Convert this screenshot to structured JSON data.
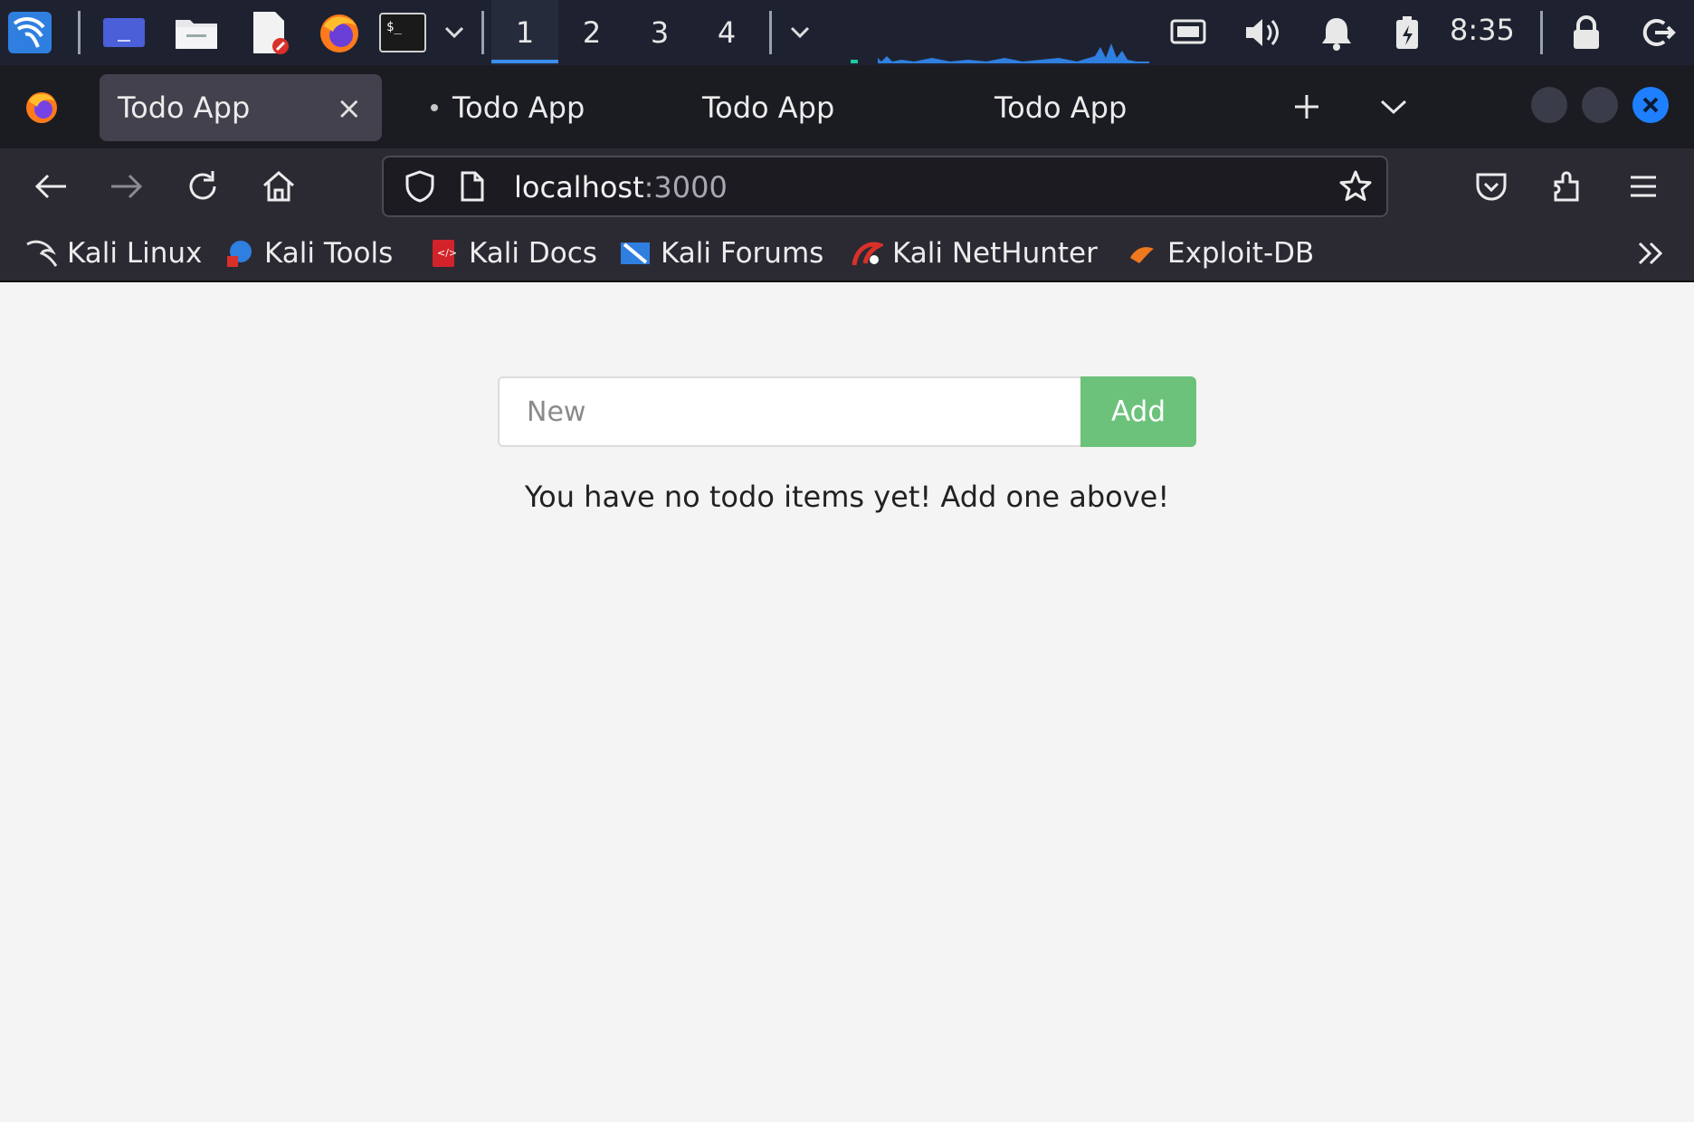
{
  "panel": {
    "workspaces": [
      "1",
      "2",
      "3",
      "4"
    ],
    "active_workspace": "1",
    "clock": "8:35"
  },
  "browser": {
    "tabs": [
      {
        "title": "Todo App",
        "active": true
      },
      {
        "title": "Todo App",
        "active": false
      },
      {
        "title": "Todo App",
        "active": false
      },
      {
        "title": "Todo App",
        "active": false
      }
    ],
    "url": {
      "host": "localhost",
      "port": ":3000"
    },
    "bookmarks": [
      "Kali Linux",
      "Kali Tools",
      "Kali Docs",
      "Kali Forums",
      "Kali NetHunter",
      "Exploit-DB"
    ]
  },
  "todo": {
    "input_placeholder": "New",
    "add_label": "Add",
    "empty_message": "You have no todo items yet! Add one above!"
  },
  "colors": {
    "panel_bg": "#1e2230",
    "accent": "#3a8ff0",
    "add_button": "#6cc27a",
    "page_bg": "#f4f4f4"
  }
}
